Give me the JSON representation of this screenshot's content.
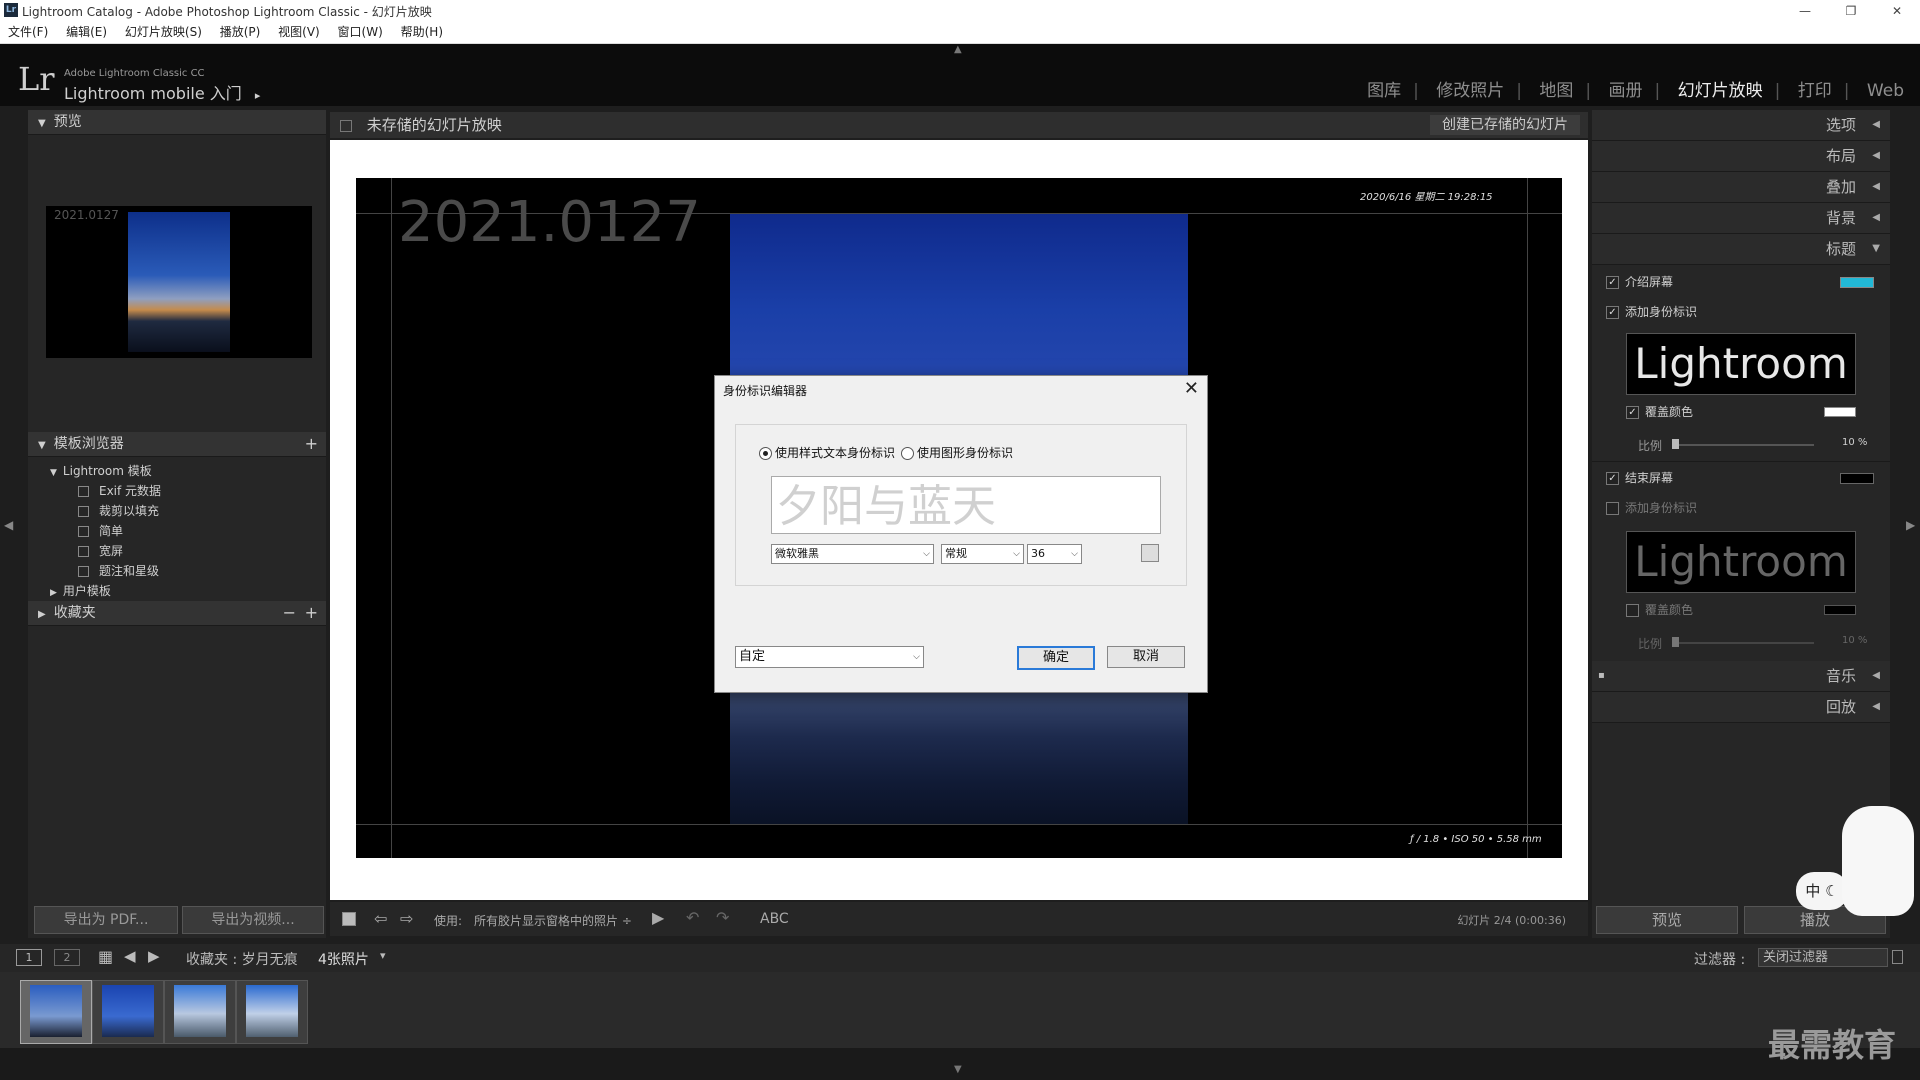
{
  "window": {
    "title": "Lightroom Catalog - Adobe Photoshop Lightroom Classic - 幻灯片放映",
    "app_icon": "Lr",
    "controls": [
      "—",
      "❐",
      "✕"
    ]
  },
  "menu": [
    "文件(F)",
    "编辑(E)",
    "幻灯片放映(S)",
    "播放(P)",
    "视图(V)",
    "窗口(W)",
    "帮助(H)"
  ],
  "identity": {
    "logo": "Lr",
    "product": "Adobe Lightroom Classic CC",
    "mobile": "Lightroom mobile 入门",
    "mobile_arrow": "▸"
  },
  "modules": [
    {
      "label": "图库",
      "active": false
    },
    {
      "label": "修改照片",
      "active": false
    },
    {
      "label": "地图",
      "active": false
    },
    {
      "label": "画册",
      "active": false
    },
    {
      "label": "幻灯片放映",
      "active": true
    },
    {
      "label": "打印",
      "active": false
    },
    {
      "label": "Web",
      "active": false
    }
  ],
  "left_panel": {
    "preview_title": "预览",
    "preview_caption": "2021.0127",
    "template_browser_title": "模板浏览器",
    "lightroom_templates": "Lightroom 模板",
    "templates": [
      "Exif 元数据",
      "裁剪以填充",
      "简单",
      "宽屏",
      "题注和星级"
    ],
    "user_templates": "用户模板",
    "collections_title": "收藏夹",
    "export_pdf": "导出为 PDF...",
    "export_video": "导出为视频..."
  },
  "center": {
    "slideshow_name": "未存储的幻灯片放映",
    "create_saved": "创建已存储的幻灯片",
    "big_date": "2021.0127",
    "datestamp": "2020/6/16 星期二  19:28:15",
    "exif": "ƒ / 1.8 • ISO 50 • 5.58 mm"
  },
  "toolbar": {
    "use_label": "使用:",
    "use_value": "所有胶片显示窗格中的照片 ÷",
    "abc": "ABC",
    "slide_count": "幻灯片 2/4 (0:00:36)"
  },
  "right_panel": {
    "sections_top": [
      "选项",
      "布局",
      "叠加",
      "背景",
      "标题"
    ],
    "intro_screen": "介绍屏幕",
    "add_identity": "添加身份标识",
    "identity_text": "Lightroom",
    "override_color": "覆盖颜色",
    "scale_label": "比例",
    "scale_value": "10 %",
    "end_screen": "结束屏幕",
    "add_identity_2": "添加身份标识",
    "identity_text_2": "Lightroom",
    "override_color_2": "覆盖颜色",
    "scale_label_2": "比例",
    "scale_value_2": "10 %",
    "sections_bottom": [
      "音乐",
      "回放"
    ],
    "preview_button": "预览",
    "play_button": "播放",
    "intro_color": "#22b8d6"
  },
  "filmstrip": {
    "page1": "1",
    "page2": "2",
    "source": "收藏夹 : 岁月无痕",
    "count": "4张照片",
    "count_arrow": "▾",
    "filter_label": "过滤器 :",
    "filter_value": "关闭过滤器"
  },
  "dialog": {
    "title": "身份标识编辑器",
    "radio_text": "使用样式文本身份标识",
    "radio_graphic": "使用图形身份标识",
    "text_value": "夕阳与蓝天",
    "font": "微软雅黑",
    "style": "常规",
    "size": "36",
    "preset": "自定",
    "ok": "确定",
    "cancel": "取消"
  },
  "ime": {
    "label": "中"
  },
  "watermark": "最需教育"
}
